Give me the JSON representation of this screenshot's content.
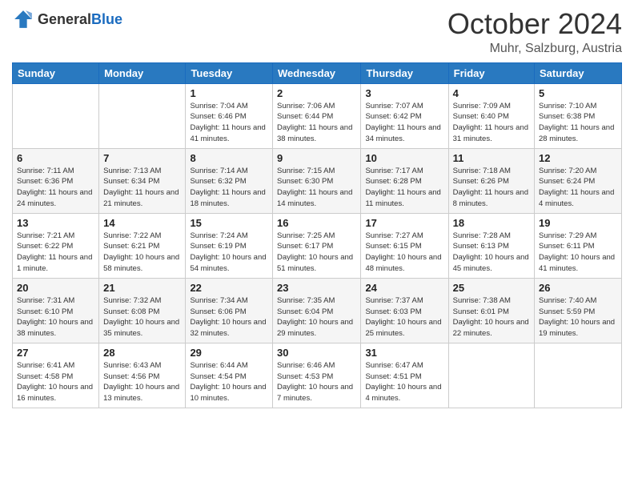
{
  "header": {
    "logo": {
      "general": "General",
      "blue": "Blue"
    },
    "title": "October 2024",
    "location": "Muhr, Salzburg, Austria"
  },
  "calendar": {
    "days_of_week": [
      "Sunday",
      "Monday",
      "Tuesday",
      "Wednesday",
      "Thursday",
      "Friday",
      "Saturday"
    ],
    "weeks": [
      [
        {
          "day": "",
          "info": ""
        },
        {
          "day": "",
          "info": ""
        },
        {
          "day": "1",
          "info": "Sunrise: 7:04 AM\nSunset: 6:46 PM\nDaylight: 11 hours and 41 minutes."
        },
        {
          "day": "2",
          "info": "Sunrise: 7:06 AM\nSunset: 6:44 PM\nDaylight: 11 hours and 38 minutes."
        },
        {
          "day": "3",
          "info": "Sunrise: 7:07 AM\nSunset: 6:42 PM\nDaylight: 11 hours and 34 minutes."
        },
        {
          "day": "4",
          "info": "Sunrise: 7:09 AM\nSunset: 6:40 PM\nDaylight: 11 hours and 31 minutes."
        },
        {
          "day": "5",
          "info": "Sunrise: 7:10 AM\nSunset: 6:38 PM\nDaylight: 11 hours and 28 minutes."
        }
      ],
      [
        {
          "day": "6",
          "info": "Sunrise: 7:11 AM\nSunset: 6:36 PM\nDaylight: 11 hours and 24 minutes."
        },
        {
          "day": "7",
          "info": "Sunrise: 7:13 AM\nSunset: 6:34 PM\nDaylight: 11 hours and 21 minutes."
        },
        {
          "day": "8",
          "info": "Sunrise: 7:14 AM\nSunset: 6:32 PM\nDaylight: 11 hours and 18 minutes."
        },
        {
          "day": "9",
          "info": "Sunrise: 7:15 AM\nSunset: 6:30 PM\nDaylight: 11 hours and 14 minutes."
        },
        {
          "day": "10",
          "info": "Sunrise: 7:17 AM\nSunset: 6:28 PM\nDaylight: 11 hours and 11 minutes."
        },
        {
          "day": "11",
          "info": "Sunrise: 7:18 AM\nSunset: 6:26 PM\nDaylight: 11 hours and 8 minutes."
        },
        {
          "day": "12",
          "info": "Sunrise: 7:20 AM\nSunset: 6:24 PM\nDaylight: 11 hours and 4 minutes."
        }
      ],
      [
        {
          "day": "13",
          "info": "Sunrise: 7:21 AM\nSunset: 6:22 PM\nDaylight: 11 hours and 1 minute."
        },
        {
          "day": "14",
          "info": "Sunrise: 7:22 AM\nSunset: 6:21 PM\nDaylight: 10 hours and 58 minutes."
        },
        {
          "day": "15",
          "info": "Sunrise: 7:24 AM\nSunset: 6:19 PM\nDaylight: 10 hours and 54 minutes."
        },
        {
          "day": "16",
          "info": "Sunrise: 7:25 AM\nSunset: 6:17 PM\nDaylight: 10 hours and 51 minutes."
        },
        {
          "day": "17",
          "info": "Sunrise: 7:27 AM\nSunset: 6:15 PM\nDaylight: 10 hours and 48 minutes."
        },
        {
          "day": "18",
          "info": "Sunrise: 7:28 AM\nSunset: 6:13 PM\nDaylight: 10 hours and 45 minutes."
        },
        {
          "day": "19",
          "info": "Sunrise: 7:29 AM\nSunset: 6:11 PM\nDaylight: 10 hours and 41 minutes."
        }
      ],
      [
        {
          "day": "20",
          "info": "Sunrise: 7:31 AM\nSunset: 6:10 PM\nDaylight: 10 hours and 38 minutes."
        },
        {
          "day": "21",
          "info": "Sunrise: 7:32 AM\nSunset: 6:08 PM\nDaylight: 10 hours and 35 minutes."
        },
        {
          "day": "22",
          "info": "Sunrise: 7:34 AM\nSunset: 6:06 PM\nDaylight: 10 hours and 32 minutes."
        },
        {
          "day": "23",
          "info": "Sunrise: 7:35 AM\nSunset: 6:04 PM\nDaylight: 10 hours and 29 minutes."
        },
        {
          "day": "24",
          "info": "Sunrise: 7:37 AM\nSunset: 6:03 PM\nDaylight: 10 hours and 25 minutes."
        },
        {
          "day": "25",
          "info": "Sunrise: 7:38 AM\nSunset: 6:01 PM\nDaylight: 10 hours and 22 minutes."
        },
        {
          "day": "26",
          "info": "Sunrise: 7:40 AM\nSunset: 5:59 PM\nDaylight: 10 hours and 19 minutes."
        }
      ],
      [
        {
          "day": "27",
          "info": "Sunrise: 6:41 AM\nSunset: 4:58 PM\nDaylight: 10 hours and 16 minutes."
        },
        {
          "day": "28",
          "info": "Sunrise: 6:43 AM\nSunset: 4:56 PM\nDaylight: 10 hours and 13 minutes."
        },
        {
          "day": "29",
          "info": "Sunrise: 6:44 AM\nSunset: 4:54 PM\nDaylight: 10 hours and 10 minutes."
        },
        {
          "day": "30",
          "info": "Sunrise: 6:46 AM\nSunset: 4:53 PM\nDaylight: 10 hours and 7 minutes."
        },
        {
          "day": "31",
          "info": "Sunrise: 6:47 AM\nSunset: 4:51 PM\nDaylight: 10 hours and 4 minutes."
        },
        {
          "day": "",
          "info": ""
        },
        {
          "day": "",
          "info": ""
        }
      ]
    ]
  }
}
